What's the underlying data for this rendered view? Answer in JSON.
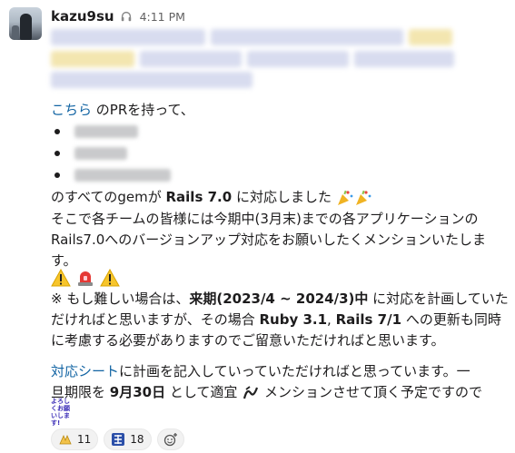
{
  "message": {
    "username": "kazu9su",
    "timestamp": "4:11 PM",
    "line_pr_link": "こちら",
    "line_pr_rest": " のPRを持って、",
    "line_rails_1": "のすべてのgemが ",
    "line_rails_bold": "Rails 7.0",
    "line_rails_2": " に対応しました ",
    "line_request_1": "そこで各チームの皆様には今期中(3月末)までの各アプリケーションの",
    "line_request_2": "Rails7.0へのバージョンアップ対応をお願いしたくメンションいたしま",
    "line_request_3": "す。",
    "note_1a": "※ もし難しい場合は、",
    "note_1b": "来期(2023/4 ~ 2024/3)中",
    "note_1c": " に対応を計画していた",
    "note_2a": "だければと思いますが、その場合 ",
    "note_2b": "Ruby 3.1",
    "note_2c": ", ",
    "note_2d": "Rails 7/1",
    "note_2e": " への更新も同時",
    "note_3": "に考慮する必要がありますのでご留意いただければと思います。",
    "sheet_link": "対応シート",
    "sheet_rest": "に計画を記入していっていただければと思っています。一",
    "deadline_1": "旦期限を ",
    "deadline_bold": "9月30日",
    "deadline_2": " として適宜 ",
    "deadline_3": " メンションさせて頂く予定ですので",
    "yoroshiku_emoji": "よろしくお願いします!"
  },
  "reactions": [
    {
      "icon": "hands-reaction-icon",
      "count": "11"
    },
    {
      "icon": "kanji-reaction-icon",
      "count": "18"
    }
  ],
  "colors": {
    "link": "#1264a3",
    "text": "#1d1c1d",
    "emoji_text": "#3d2fb8"
  }
}
